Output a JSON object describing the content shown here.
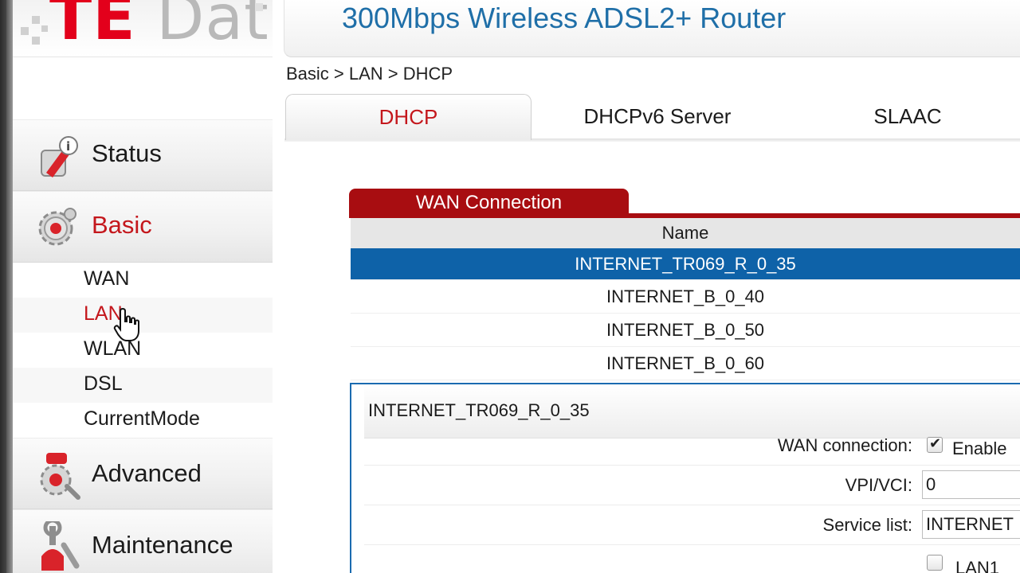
{
  "logo": {
    "brand_part1": "TE",
    "brand_part2": "Data"
  },
  "header": {
    "title": "300Mbps Wireless ADSL2+ Router"
  },
  "breadcrumb": "Basic > LAN > DHCP",
  "sidebar": {
    "menus": [
      {
        "label": "Status",
        "icon": "status-info-icon"
      },
      {
        "label": "Basic",
        "icon": "gear-icon"
      },
      {
        "label": "Advanced",
        "icon": "advanced-tools-icon"
      },
      {
        "label": "Maintenance",
        "icon": "maintenance-wrench-icon"
      }
    ],
    "basic_items": [
      {
        "label": "WAN"
      },
      {
        "label": "LAN"
      },
      {
        "label": "WLAN"
      },
      {
        "label": "DSL"
      },
      {
        "label": "CurrentMode"
      }
    ]
  },
  "tabs": [
    {
      "label": "DHCP"
    },
    {
      "label": "DHCPv6 Server"
    },
    {
      "label": "SLAAC"
    }
  ],
  "wan_panel": {
    "title": "WAN Connection",
    "column_name": "Name",
    "rows": [
      "INTERNET_TR069_R_0_35",
      "INTERNET_B_0_40",
      "INTERNET_B_0_50",
      "INTERNET_B_0_60"
    ]
  },
  "details": {
    "title": "INTERNET_TR069_R_0_35",
    "wan_connection_label": "WAN connection:",
    "enable_label": "Enable",
    "vpi_vci_label": "VPI/VCI:",
    "vpi_value": "0",
    "service_list_label": "Service list:",
    "service_list_value": "INTERNET",
    "lan1_label": "LAN1"
  },
  "colors": {
    "accent_red": "#c4171c",
    "panel_red": "#a80d11",
    "selected_blue": "#0e62a8",
    "title_blue": "#1f6fa8"
  }
}
